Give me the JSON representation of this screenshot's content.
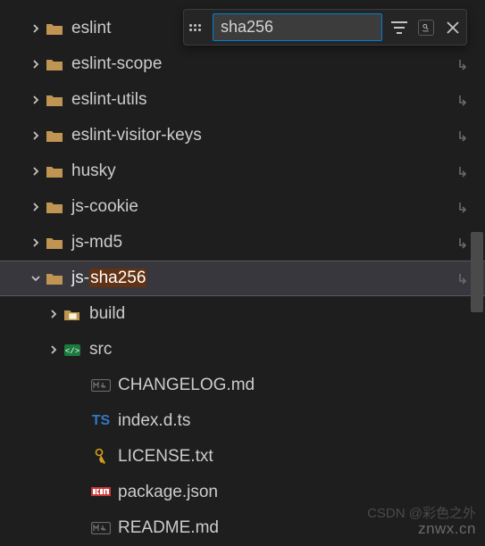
{
  "search": {
    "value": "sha256"
  },
  "tree": {
    "items": [
      {
        "name": "eslint",
        "kind": "folder",
        "expanded": false,
        "depth": 1,
        "wrap": false
      },
      {
        "name": "eslint-scope",
        "kind": "folder",
        "expanded": false,
        "depth": 1,
        "wrap": true
      },
      {
        "name": "eslint-utils",
        "kind": "folder",
        "expanded": false,
        "depth": 1,
        "wrap": true
      },
      {
        "name": "eslint-visitor-keys",
        "kind": "folder",
        "expanded": false,
        "depth": 1,
        "wrap": true
      },
      {
        "name": "husky",
        "kind": "folder",
        "expanded": false,
        "depth": 1,
        "wrap": true
      },
      {
        "name": "js-cookie",
        "kind": "folder",
        "expanded": false,
        "depth": 1,
        "wrap": true
      },
      {
        "name": "js-md5",
        "kind": "folder",
        "expanded": false,
        "depth": 1,
        "wrap": true
      },
      {
        "name": "js-sha256",
        "kind": "folder",
        "expanded": true,
        "depth": 1,
        "wrap": true,
        "selected": true,
        "match": "sha256"
      },
      {
        "name": "build",
        "kind": "folder-open",
        "expanded": false,
        "depth": 2,
        "wrap": false
      },
      {
        "name": "src",
        "kind": "folder-src",
        "expanded": false,
        "depth": 2,
        "wrap": false
      },
      {
        "name": "CHANGELOG.md",
        "kind": "md",
        "depth": 2,
        "wrap": false
      },
      {
        "name": "index.d.ts",
        "kind": "ts",
        "depth": 2,
        "wrap": false
      },
      {
        "name": "LICENSE.txt",
        "kind": "key",
        "depth": 2,
        "wrap": false
      },
      {
        "name": "package.json",
        "kind": "npm",
        "depth": 2,
        "wrap": false
      },
      {
        "name": "README.md",
        "kind": "md",
        "depth": 2,
        "wrap": false
      }
    ]
  },
  "watermark_top": "CSDN @彩色之外",
  "watermark_bottom": "znwx.cn"
}
